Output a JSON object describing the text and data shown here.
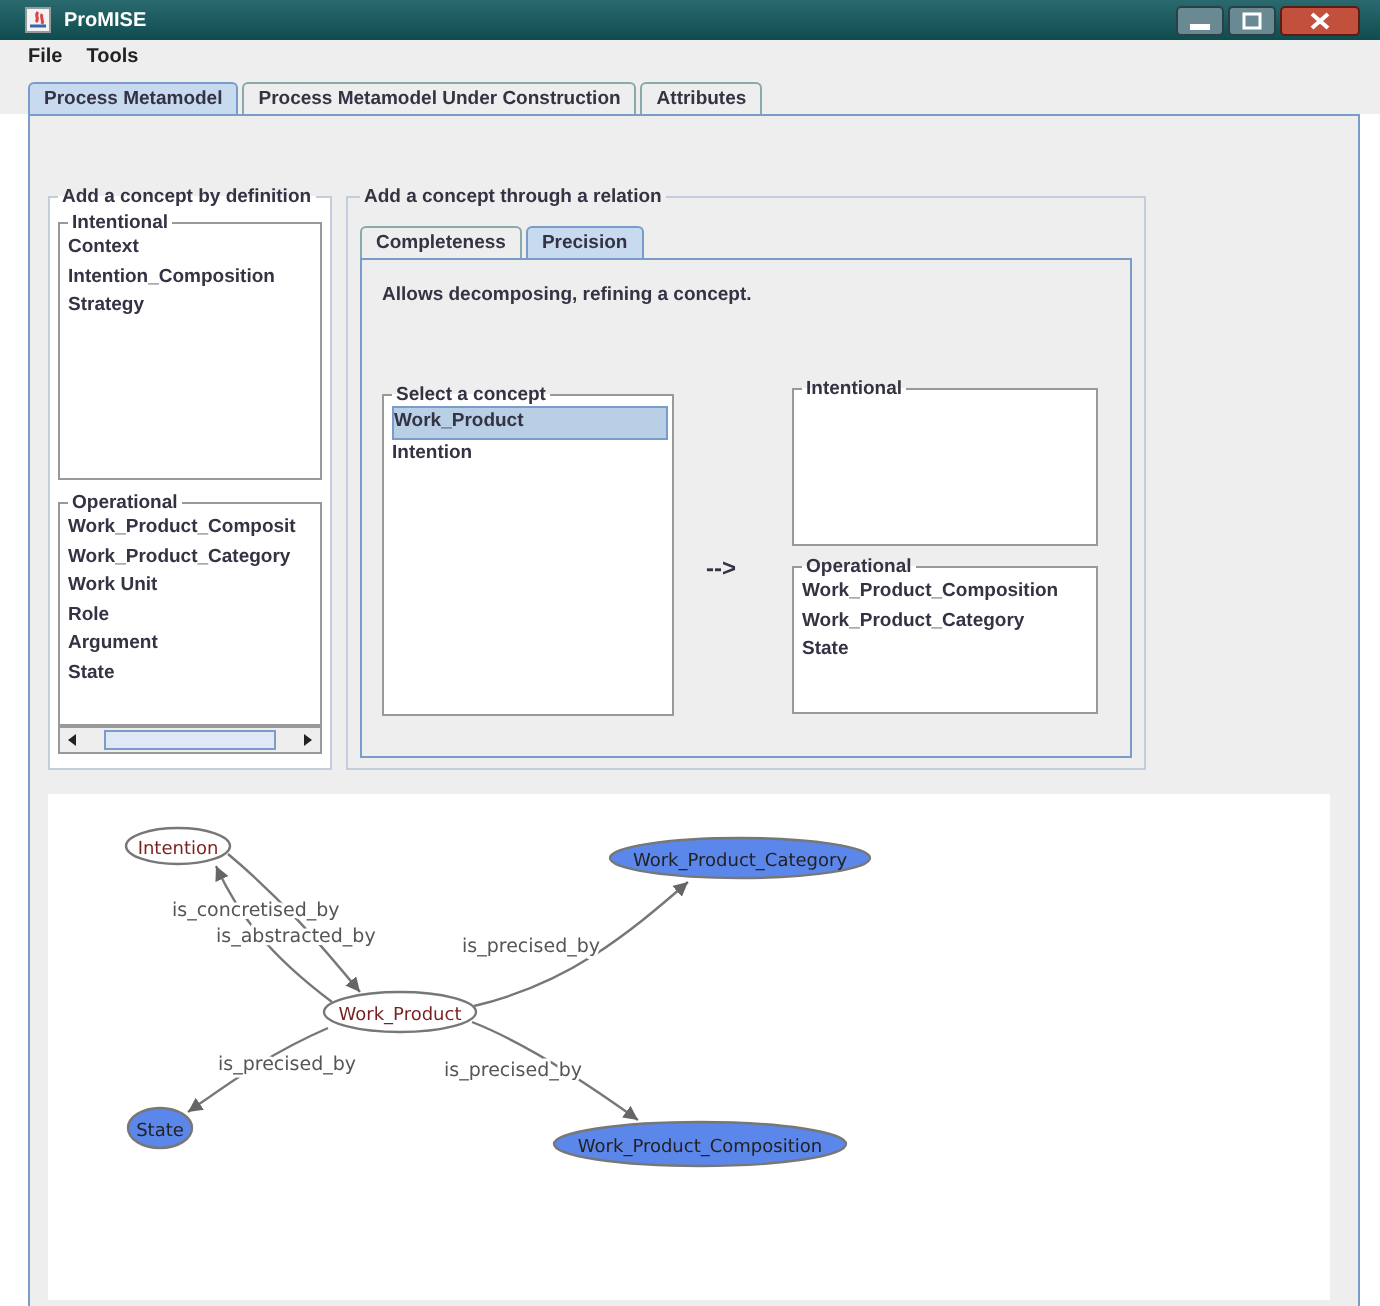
{
  "window": {
    "title": "ProMISE"
  },
  "menu": [
    "File",
    "Tools"
  ],
  "tabs": [
    {
      "label": "Process Metamodel",
      "selected": true
    },
    {
      "label": "Process Metamodel Under Construction",
      "selected": false
    },
    {
      "label": "Attributes",
      "selected": false
    }
  ],
  "definition_panel": {
    "title": "Add a concept by definition",
    "intentional": {
      "title": "Intentional",
      "items": [
        "Context",
        "Intention_Composition",
        "Strategy"
      ]
    },
    "operational": {
      "title": "Operational",
      "items": [
        "Work_Product_Composit",
        "Work_Product_Category",
        "Work  Unit",
        "Role",
        "Argument",
        "State"
      ]
    }
  },
  "relation_panel": {
    "title": "Add a concept through a relation",
    "tabs": [
      {
        "label": "Completeness",
        "selected": false
      },
      {
        "label": "Precision",
        "selected": true
      }
    ],
    "description": "Allows decomposing, refining a concept.",
    "select_list": {
      "title": "Select a concept",
      "items": [
        {
          "label": "Work_Product",
          "selected": true
        },
        {
          "label": "Intention",
          "selected": false
        }
      ]
    },
    "arrow": "-->",
    "intentional": {
      "title": "Intentional"
    },
    "operational": {
      "title": "Operational",
      "items": [
        "Work_Product_Composition",
        "Work_Product_Category",
        "State"
      ]
    }
  },
  "graph": {
    "nodes": [
      {
        "label": "Intention",
        "kind": "intentional"
      },
      {
        "label": "Work_Product",
        "kind": "intentional"
      },
      {
        "label": "Work_Product_Category",
        "kind": "operational"
      },
      {
        "label": "State",
        "kind": "operational"
      },
      {
        "label": "Work_Product_Composition",
        "kind": "operational"
      }
    ],
    "edges": [
      {
        "label": "is_concretised_by"
      },
      {
        "label": "is_abstracted_by"
      },
      {
        "label": "is_precised_by"
      },
      {
        "label": "is_precised_by"
      },
      {
        "label": "is_precised_by"
      }
    ]
  }
}
